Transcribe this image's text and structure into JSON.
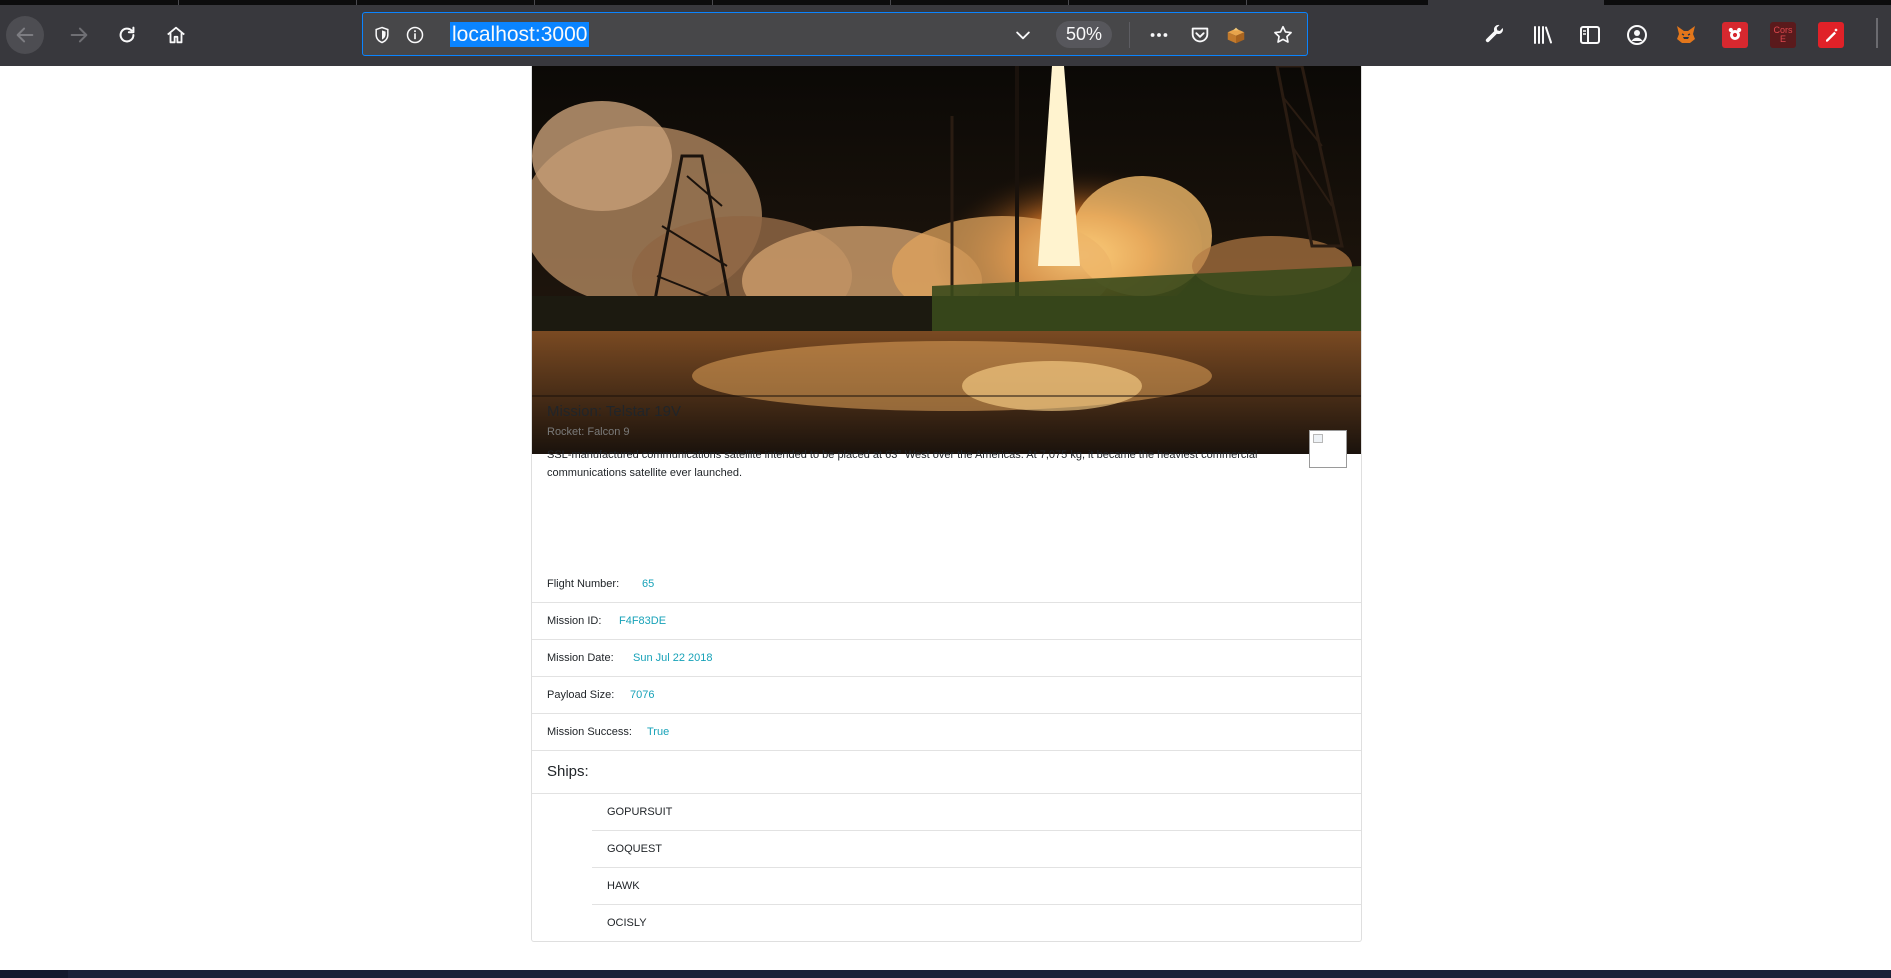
{
  "browser": {
    "url": "localhost:3000",
    "zoom": "50%",
    "icons": {
      "back": "back-arrow-icon",
      "forward": "forward-arrow-icon",
      "reload": "reload-icon",
      "home": "home-icon",
      "shield": "tracking-shield-icon",
      "info": "site-info-icon",
      "dropdown": "chevron-down-icon",
      "more": "page-actions-ellipsis-icon",
      "pocket": "pocket-icon",
      "extension": "extension-fox-box-icon",
      "bookmark": "bookmark-star-icon",
      "toolbar": [
        "developer-wrench-icon",
        "library-icon",
        "sidebar-icon",
        "account-icon",
        "metamask-fox-icon",
        "extension-red-icon",
        "cors-extension-icon",
        "red-pen-extension-icon"
      ]
    },
    "cors_ext_label": "Cors\nE"
  },
  "launch": {
    "mission_title": "Mission: Telstar 19V",
    "rocket": "Rocket: Falcon 9",
    "details": "SSL-manufactured communications satellite intended to be placed at 63° West over the Americas. At 7,075 kg, it became the heaviest commercial communications satellite ever launched.",
    "fields": [
      {
        "label": "Flight Number:",
        "value": "65"
      },
      {
        "label": "Mission ID:",
        "value": "F4F83DE"
      },
      {
        "label": "Mission Date:",
        "value": "Sun Jul 22 2018"
      },
      {
        "label": "Payload Size:",
        "value": "7076"
      },
      {
        "label": "Mission Success:",
        "value": "True"
      }
    ],
    "ships_label": "Ships:",
    "ships": [
      "GOPURSUIT",
      "GOQUEST",
      "HAWK",
      "OCISLY"
    ]
  },
  "colors": {
    "chrome_bg": "#38383d",
    "url_highlight": "#0a84ff",
    "value_text": "#17a2b8"
  }
}
